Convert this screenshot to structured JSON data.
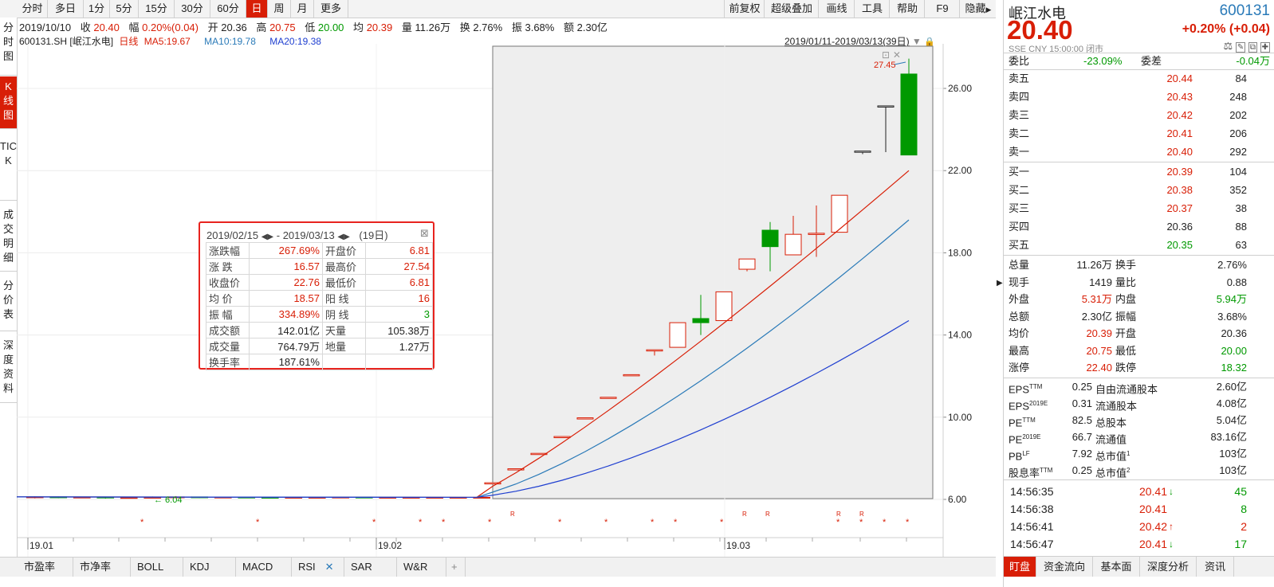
{
  "periods": [
    "分时",
    "多日",
    "1分",
    "5分",
    "15分",
    "30分",
    "60分",
    "日",
    "周",
    "月",
    "更多"
  ],
  "active_period": "日",
  "tools": [
    "前复权",
    "超级叠加",
    "画线",
    "工具",
    "帮助",
    "F9",
    "隐藏"
  ],
  "left_tabs": [
    "分时图",
    "K线图",
    "TICK",
    "成交明细",
    "分价表",
    "深度资料"
  ],
  "info_line": {
    "date": "2019/10/10",
    "close_label": "收",
    "close": "20.40",
    "range_label": "幅",
    "range": "0.20%(0.04)",
    "open_label": "开",
    "open": "20.36",
    "high_label": "高",
    "high": "20.75",
    "low_label": "低",
    "low": "20.00",
    "avg_label": "均",
    "avg": "20.39",
    "vol_label": "量",
    "vol": "11.26万",
    "turn_label": "换",
    "turn": "2.76%",
    "amp_label": "振",
    "amp": "3.68%",
    "amt_label": "额",
    "amt": "2.30亿"
  },
  "ma_line": {
    "code": "600131.SH",
    "name": "[岷江水电]",
    "period": "日线",
    "ma5": "MA5:19.67",
    "ma10": "MA10:19.78",
    "ma20": "MA20:19.38"
  },
  "range_label": "2019/01/11-2019/03/13(39日)",
  "tooltip": {
    "date_from": "2019/02/15",
    "date_to": "2019/03/13",
    "sep": "-",
    "days": "(19日)",
    "rows": [
      [
        "涨跌幅",
        "267.69%",
        "开盘价",
        "6.81"
      ],
      [
        "涨  跌",
        "16.57",
        "最高价",
        "27.54"
      ],
      [
        "收盘价",
        "22.76",
        "最低价",
        "6.81"
      ],
      [
        "均  价",
        "18.57",
        "阳  线",
        "16"
      ],
      [
        "振  幅",
        "334.89%",
        "阴  线",
        "3"
      ],
      [
        "成交额",
        "142.01亿",
        "天量",
        "105.38万"
      ],
      [
        "成交量",
        "764.79万",
        "地量",
        "1.27万"
      ],
      [
        "换手率",
        "187.61%",
        "",
        ""
      ]
    ]
  },
  "chart_data": {
    "type": "candlestick",
    "y_ticks": [
      "26.00",
      "22.00",
      "18.00",
      "14.00",
      "10.00",
      "6.00"
    ],
    "x_ticks": [
      "19.01",
      "19.02",
      "19.03"
    ],
    "ylim": [
      6.0,
      26.0
    ],
    "max_label": "27.45",
    "min_label": "6.04",
    "flat_candles": [
      {
        "o": 6.1,
        "c": 6.12,
        "h": 6.15,
        "l": 6.05
      },
      {
        "o": 6.12,
        "c": 6.1,
        "h": 6.14,
        "l": 6.06
      },
      {
        "o": 6.1,
        "c": 6.11,
        "h": 6.13,
        "l": 6.07
      },
      {
        "o": 6.11,
        "c": 6.08,
        "h": 6.12,
        "l": 6.04
      },
      {
        "o": 6.08,
        "c": 6.09,
        "h": 6.12,
        "l": 6.04
      },
      {
        "o": 6.09,
        "c": 6.1,
        "h": 6.14,
        "l": 6.06
      },
      {
        "o": 6.1,
        "c": 6.12,
        "h": 6.16,
        "l": 6.08
      },
      {
        "o": 6.12,
        "c": 6.1,
        "h": 6.13,
        "l": 6.07
      },
      {
        "o": 6.1,
        "c": 6.11,
        "h": 6.13,
        "l": 6.08
      },
      {
        "o": 6.11,
        "c": 6.1,
        "h": 6.12,
        "l": 6.07
      },
      {
        "o": 6.1,
        "c": 6.09,
        "h": 6.12,
        "l": 6.07
      },
      {
        "o": 6.09,
        "c": 6.1,
        "h": 6.11,
        "l": 6.07
      },
      {
        "o": 6.1,
        "c": 6.1,
        "h": 6.12,
        "l": 6.08
      },
      {
        "o": 6.1,
        "c": 6.11,
        "h": 6.12,
        "l": 6.08
      },
      {
        "o": 6.11,
        "c": 6.1,
        "h": 6.12,
        "l": 6.08
      },
      {
        "o": 6.1,
        "c": 6.1,
        "h": 6.11,
        "l": 6.08
      },
      {
        "o": 6.1,
        "c": 6.1,
        "h": 6.11,
        "l": 6.09
      },
      {
        "o": 6.1,
        "c": 6.1,
        "h": 6.11,
        "l": 6.09
      },
      {
        "o": 6.1,
        "c": 6.1,
        "h": 6.11,
        "l": 6.09
      },
      {
        "o": 6.1,
        "c": 6.1,
        "h": 6.11,
        "l": 6.09
      }
    ],
    "rise_candles": [
      {
        "o": 6.81,
        "c": 6.81,
        "h": 6.81,
        "l": 6.81
      },
      {
        "o": 7.49,
        "c": 7.49,
        "h": 7.49,
        "l": 7.49
      },
      {
        "o": 8.24,
        "c": 8.24,
        "h": 8.24,
        "l": 8.24
      },
      {
        "o": 9.06,
        "c": 9.06,
        "h": 9.06,
        "l": 9.06
      },
      {
        "o": 9.97,
        "c": 9.97,
        "h": 9.97,
        "l": 9.97
      },
      {
        "o": 10.97,
        "c": 10.97,
        "h": 10.97,
        "l": 10.97
      },
      {
        "o": 12.07,
        "c": 12.07,
        "h": 12.07,
        "l": 12.07
      },
      {
        "o": 13.25,
        "c": 13.28,
        "h": 13.28,
        "l": 13.0
      },
      {
        "o": 13.4,
        "c": 14.6,
        "h": 14.6,
        "l": 13.4
      },
      {
        "o": 14.8,
        "c": 14.6,
        "h": 15.95,
        "l": 14.0
      },
      {
        "o": 14.7,
        "c": 16.1,
        "h": 16.1,
        "l": 14.7
      },
      {
        "o": 17.2,
        "c": 17.7,
        "h": 17.7,
        "l": 17.1
      },
      {
        "o": 19.1,
        "c": 18.3,
        "h": 19.5,
        "l": 17.1
      },
      {
        "o": 17.9,
        "c": 18.9,
        "h": 19.8,
        "l": 17.9
      },
      {
        "o": 18.9,
        "c": 18.95,
        "h": 20.3,
        "l": 17.8
      },
      {
        "o": 19.0,
        "c": 20.8,
        "h": 20.8,
        "l": 19.0
      },
      {
        "o": 22.9,
        "c": 22.95,
        "h": 22.95,
        "l": 22.8
      },
      {
        "o": 25.1,
        "c": 25.15,
        "h": 25.15,
        "l": 22.9
      },
      {
        "o": 26.7,
        "c": 22.76,
        "h": 27.45,
        "l": 22.76
      }
    ],
    "ma5_end": 22.0,
    "ma10_end": 19.6,
    "ma20_end": 14.7,
    "marker_R": "R",
    "marker_star": "*"
  },
  "bottom_tabs": [
    "市盈率",
    "市净率",
    "BOLL",
    "KDJ",
    "MACD",
    "RSI",
    "SAR",
    "W&R",
    "+"
  ],
  "quote": {
    "name": "岷江水电",
    "code": "600131",
    "price": "20.40",
    "change": "+0.20% (+0.04)",
    "market": "SSE",
    "currency": "CNY",
    "time": "15:00:00",
    "status": "闭市"
  },
  "commission": {
    "ratio_label": "委比",
    "ratio": "-23.09%",
    "diff_label": "委差",
    "diff": "-0.04万"
  },
  "asks": [
    {
      "label": "卖五",
      "price": "20.44",
      "vol": "84"
    },
    {
      "label": "卖四",
      "price": "20.43",
      "vol": "248"
    },
    {
      "label": "卖三",
      "price": "20.42",
      "vol": "202"
    },
    {
      "label": "卖二",
      "price": "20.41",
      "vol": "206"
    },
    {
      "label": "卖一",
      "price": "20.40",
      "vol": "292"
    }
  ],
  "bids": [
    {
      "label": "买一",
      "price": "20.39",
      "vol": "104"
    },
    {
      "label": "买二",
      "price": "20.38",
      "vol": "352"
    },
    {
      "label": "买三",
      "price": "20.37",
      "vol": "38"
    },
    {
      "label": "买四",
      "price": "20.36",
      "vol": "88"
    },
    {
      "label": "买五",
      "price": "20.35",
      "vol": "63"
    }
  ],
  "stats": [
    [
      "总量",
      "11.26万",
      "换手",
      "2.76%"
    ],
    [
      "现手",
      "1419",
      "量比",
      "0.88"
    ],
    [
      "外盘",
      "5.31万",
      "内盘",
      "5.94万"
    ],
    [
      "总额",
      "2.30亿",
      "振幅",
      "3.68%"
    ],
    [
      "均价",
      "20.39",
      "开盘",
      "20.36"
    ],
    [
      "最高",
      "20.75",
      "最低",
      "20.00"
    ],
    [
      "涨停",
      "22.40",
      "跌停",
      "18.32"
    ]
  ],
  "fundamentals": [
    [
      "EPS",
      "TTM",
      "0.25",
      "自由流通股本",
      "",
      "2.60亿"
    ],
    [
      "EPS",
      "2019E",
      "0.31",
      "流通股本",
      "",
      "4.08亿"
    ],
    [
      "PE",
      "TTM",
      "82.5",
      "总股本",
      "",
      "5.04亿"
    ],
    [
      "PE",
      "2019E",
      "66.7",
      "流通值",
      "",
      "83.16亿"
    ],
    [
      "PB",
      "LF",
      "7.92",
      "总市值",
      "1",
      "103亿"
    ],
    [
      "股息率",
      "TTM",
      "0.25",
      "总市值",
      "2",
      "103亿"
    ]
  ],
  "ticks": [
    {
      "time": "14:56:35",
      "price": "20.41",
      "arrow": "↓",
      "vol": "45"
    },
    {
      "time": "14:56:38",
      "price": "20.41",
      "arrow": "",
      "vol": "8"
    },
    {
      "time": "14:56:41",
      "price": "20.42",
      "arrow": "↑",
      "vol": "2"
    },
    {
      "time": "14:56:47",
      "price": "20.41",
      "arrow": "↓",
      "vol": "17"
    }
  ],
  "right_tabs": [
    "盯盘",
    "资金流向",
    "基本面",
    "深度分析",
    "资讯"
  ],
  "colors": {
    "up": "#d81e06",
    "down": "#009900",
    "ma5": "#d81e06",
    "ma10": "#2a7ab8",
    "ma20": "#1f3fd0"
  }
}
